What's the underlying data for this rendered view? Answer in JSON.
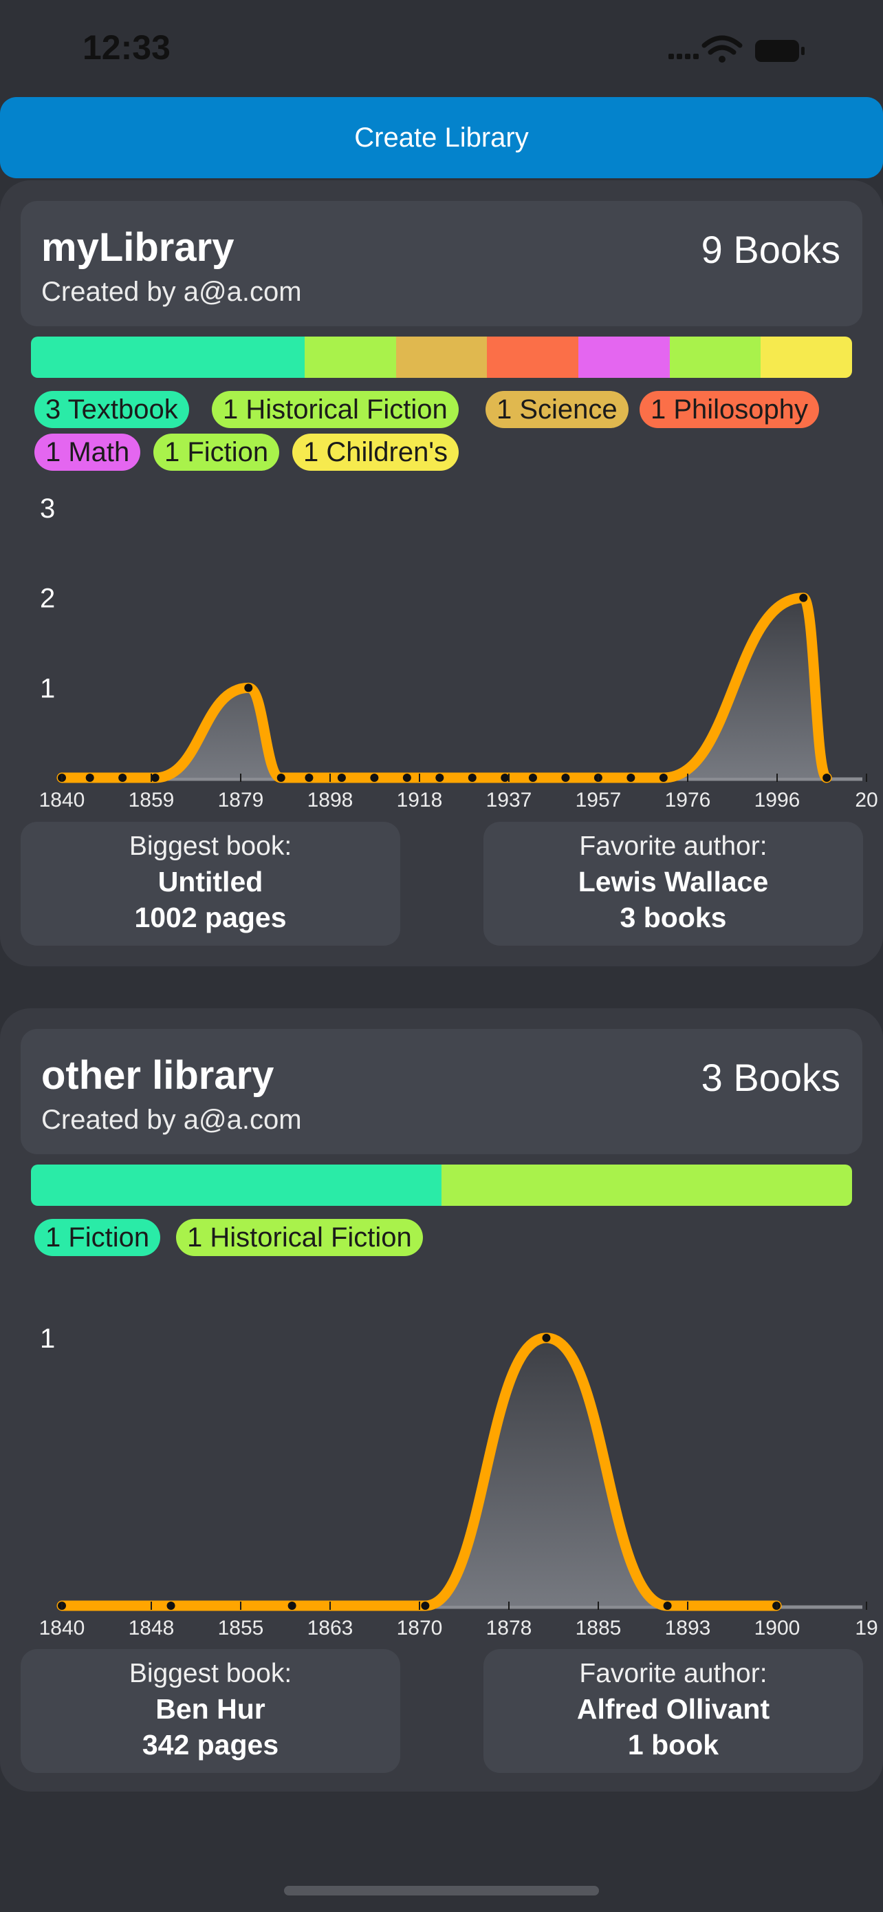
{
  "status": {
    "time": "12:33"
  },
  "create_button": {
    "label": "Create Library"
  },
  "colors": {
    "accent": "#0483cc",
    "orange": "#ffa500",
    "textbook": "#2aeba7",
    "historical_fiction": "#a9f24b",
    "science": "#e0b84f",
    "philosophy": "#fb6f48",
    "math": "#e466f0",
    "fiction": "#a9f24b",
    "childrens": "#f6ea4e"
  },
  "libraries": [
    {
      "title": "myLibrary",
      "owner": "Created by a@a.com",
      "count": "9 Books",
      "genres": [
        {
          "label": "3 Textbook",
          "count": 3,
          "color": "#2aeba7"
        },
        {
          "label": "1 Historical Fiction",
          "count": 1,
          "color": "#a9f24b"
        },
        {
          "label": "1 Science",
          "count": 1,
          "color": "#e0b84f"
        },
        {
          "label": "1 Philosophy",
          "count": 1,
          "color": "#fb6f48"
        },
        {
          "label": "1 Math",
          "count": 1,
          "color": "#e466f0"
        },
        {
          "label": "1 Fiction",
          "count": 1,
          "color": "#a9f24b"
        },
        {
          "label": "1 Children's",
          "count": 1,
          "color": "#f6ea4e"
        }
      ],
      "biggest": {
        "label": "Biggest book:",
        "title": "Untitled",
        "pages": "1002 pages"
      },
      "author": {
        "label": "Favorite author:",
        "name": "Lewis Wallace",
        "books": "3 books"
      }
    },
    {
      "title": "other library",
      "owner": "Created by a@a.com",
      "count": "3 Books",
      "genres": [
        {
          "label": "1 Fiction",
          "count": 1,
          "color": "#2aeba7"
        },
        {
          "label": "1 Historical Fiction",
          "count": 1,
          "color": "#a9f24b"
        }
      ],
      "biggest": {
        "label": "Biggest book:",
        "title": "Ben Hur",
        "pages": "342 pages"
      },
      "author": {
        "label": "Favorite author:",
        "name": "Alfred Ollivant",
        "books": "1 book"
      }
    }
  ],
  "chart_data": [
    {
      "type": "area",
      "x_ticks": [
        "1840",
        "1859",
        "1879",
        "1898",
        "1918",
        "1937",
        "1957",
        "1976",
        "1996",
        "20"
      ],
      "y_ticks": [
        "1",
        "2",
        "3"
      ],
      "ylim": [
        0,
        3
      ],
      "xlim": [
        1840,
        2014
      ],
      "points": [
        {
          "x": 1840,
          "y": 0
        },
        {
          "x": 1846,
          "y": 0
        },
        {
          "x": 1853,
          "y": 0
        },
        {
          "x": 1860,
          "y": 0
        },
        {
          "x": 1880,
          "y": 1
        },
        {
          "x": 1887,
          "y": 0
        },
        {
          "x": 1893,
          "y": 0
        },
        {
          "x": 1900,
          "y": 0
        },
        {
          "x": 1907,
          "y": 0
        },
        {
          "x": 1914,
          "y": 0
        },
        {
          "x": 1921,
          "y": 0
        },
        {
          "x": 1928,
          "y": 0
        },
        {
          "x": 1935,
          "y": 0
        },
        {
          "x": 1941,
          "y": 0
        },
        {
          "x": 1948,
          "y": 0
        },
        {
          "x": 1955,
          "y": 0
        },
        {
          "x": 1962,
          "y": 0
        },
        {
          "x": 1969,
          "y": 0
        },
        {
          "x": 1999,
          "y": 2
        },
        {
          "x": 2004,
          "y": 0
        }
      ],
      "grid": false
    },
    {
      "type": "area",
      "x_ticks": [
        "1840",
        "1848",
        "1855",
        "1863",
        "1870",
        "1878",
        "1885",
        "1893",
        "1900",
        "19"
      ],
      "y_ticks": [
        "1"
      ],
      "ylim": [
        0,
        1.1
      ],
      "xlim": [
        1840,
        1907
      ],
      "points": [
        {
          "x": 1840,
          "y": 0
        },
        {
          "x": 1849,
          "y": 0
        },
        {
          "x": 1859,
          "y": 0
        },
        {
          "x": 1870,
          "y": 0
        },
        {
          "x": 1880,
          "y": 1
        },
        {
          "x": 1890,
          "y": 0
        },
        {
          "x": 1899,
          "y": 0
        }
      ],
      "grid": false
    }
  ]
}
